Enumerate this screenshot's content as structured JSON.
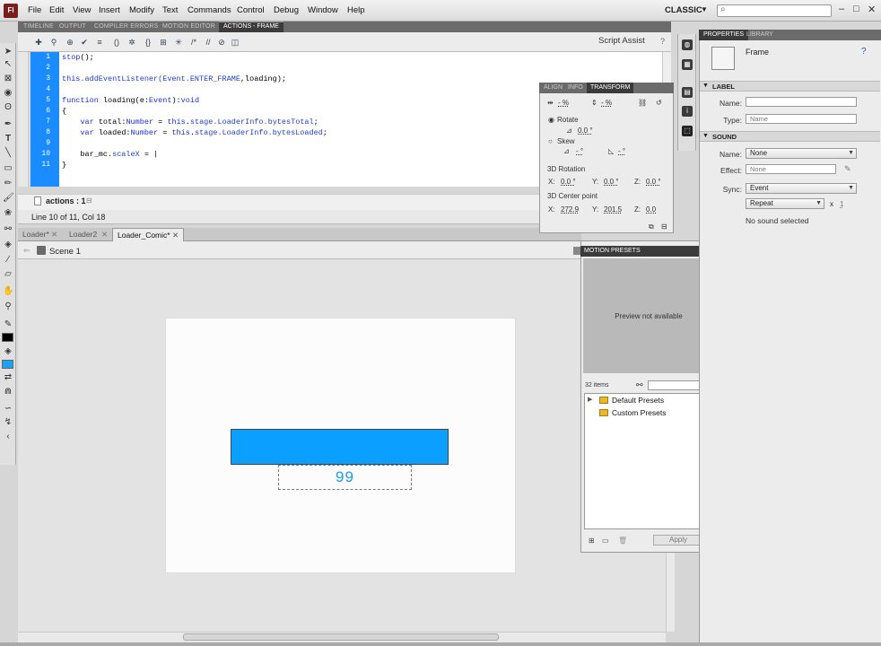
{
  "app": {
    "logo": "Fl",
    "workspace": "CLASSIC",
    "search_placeholder": ""
  },
  "menu": [
    "File",
    "Edit",
    "View",
    "Insert",
    "Modify",
    "Text",
    "Commands",
    "Control",
    "Debug",
    "Window",
    "Help"
  ],
  "panel_tabs": {
    "timeline": "TIMELINE",
    "output": "OUTPUT",
    "compiler_errors": "COMPILER ERRORS",
    "motion_editor": "MOTION EDITOR",
    "actions_frame": "ACTIONS - FRAME"
  },
  "actions": {
    "script_assist": "Script Assist",
    "line_numbers": [
      "1",
      "2",
      "3",
      "4",
      "5",
      "6",
      "7",
      "8",
      "9",
      "10",
      "11"
    ],
    "tab_label": "actions : 1",
    "status": "Line 10 of 11, Col 18"
  },
  "code": {
    "l1a": "stop",
    "l1b": "();",
    "l3a": "this",
    "l3b": ".addEventListener(Event.",
    "l3c": "ENTER_FRAME",
    "l3d": ",loading);",
    "l5a": "function",
    "l5b": " loading(e:",
    "l5c": "Event",
    "l5d": "):",
    "l5e": "void",
    "l6": "{",
    "l7a": "    var",
    "l7b": " total:",
    "l7c": "Number",
    "l7d": " = ",
    "l7e": "this",
    "l7f": ".",
    "l7g": "stage",
    "l7h": ".LoaderInfo.",
    "l7i": "bytesTotal",
    "l7j": ";",
    "l8a": "    var",
    "l8b": " loaded:",
    "l8c": "Number",
    "l8d": " = ",
    "l8e": "this",
    "l8f": ".",
    "l8g": "stage",
    "l8h": ".LoaderInfo.",
    "l8i": "bytesLoaded",
    "l8j": ";",
    "l10a": "    bar_mc.",
    "l10b": "scaleX",
    "l10c": " = |",
    "l11": "}"
  },
  "documents": {
    "tabs": [
      "Loader*",
      "Loader2",
      "Loader_Comic*"
    ],
    "scene": "Scene 1"
  },
  "stage": {
    "percent": "99",
    "bar_color": "#0ba0ff"
  },
  "transform": {
    "tabs": [
      "ALIGN",
      "INFO",
      "TRANSFORM"
    ],
    "width_pct": "- %",
    "height_pct": "- %",
    "rotate_label": "Rotate",
    "rotate_value": "0.0 °",
    "skew_label": "Skew",
    "skew_h": "- °",
    "skew_v": "- °",
    "rot3d_label": "3D Rotation",
    "x_label": "X:",
    "y_label": "Y:",
    "z_label": "Z:",
    "rot_x": "0.0 °",
    "rot_y": "0.0 °",
    "rot_z": "0.0 °",
    "center_label": "3D Center point",
    "center_x": "272.9",
    "center_y": "201.5",
    "center_z": "0.0"
  },
  "motion_presets": {
    "title": "MOTION PRESETS",
    "preview": "Preview not available",
    "count": "32 items",
    "items": [
      "Default Presets",
      "Custom Presets"
    ],
    "apply": "Apply"
  },
  "properties": {
    "tabs": [
      "PROPERTIES",
      "LIBRARY"
    ],
    "object": "Frame",
    "label_section": "LABEL",
    "name_label": "Name:",
    "type_label": "Type:",
    "type_value": "Name",
    "sound_section": "SOUND",
    "sound_name_label": "Name:",
    "sound_name_value": "None",
    "effect_label": "Effect:",
    "effect_value": "None",
    "sync_label": "Sync:",
    "sync_value": "Event",
    "repeat_value": "Repeat",
    "repeat_x": "x",
    "repeat_count": "1",
    "no_sound": "No sound selected"
  }
}
